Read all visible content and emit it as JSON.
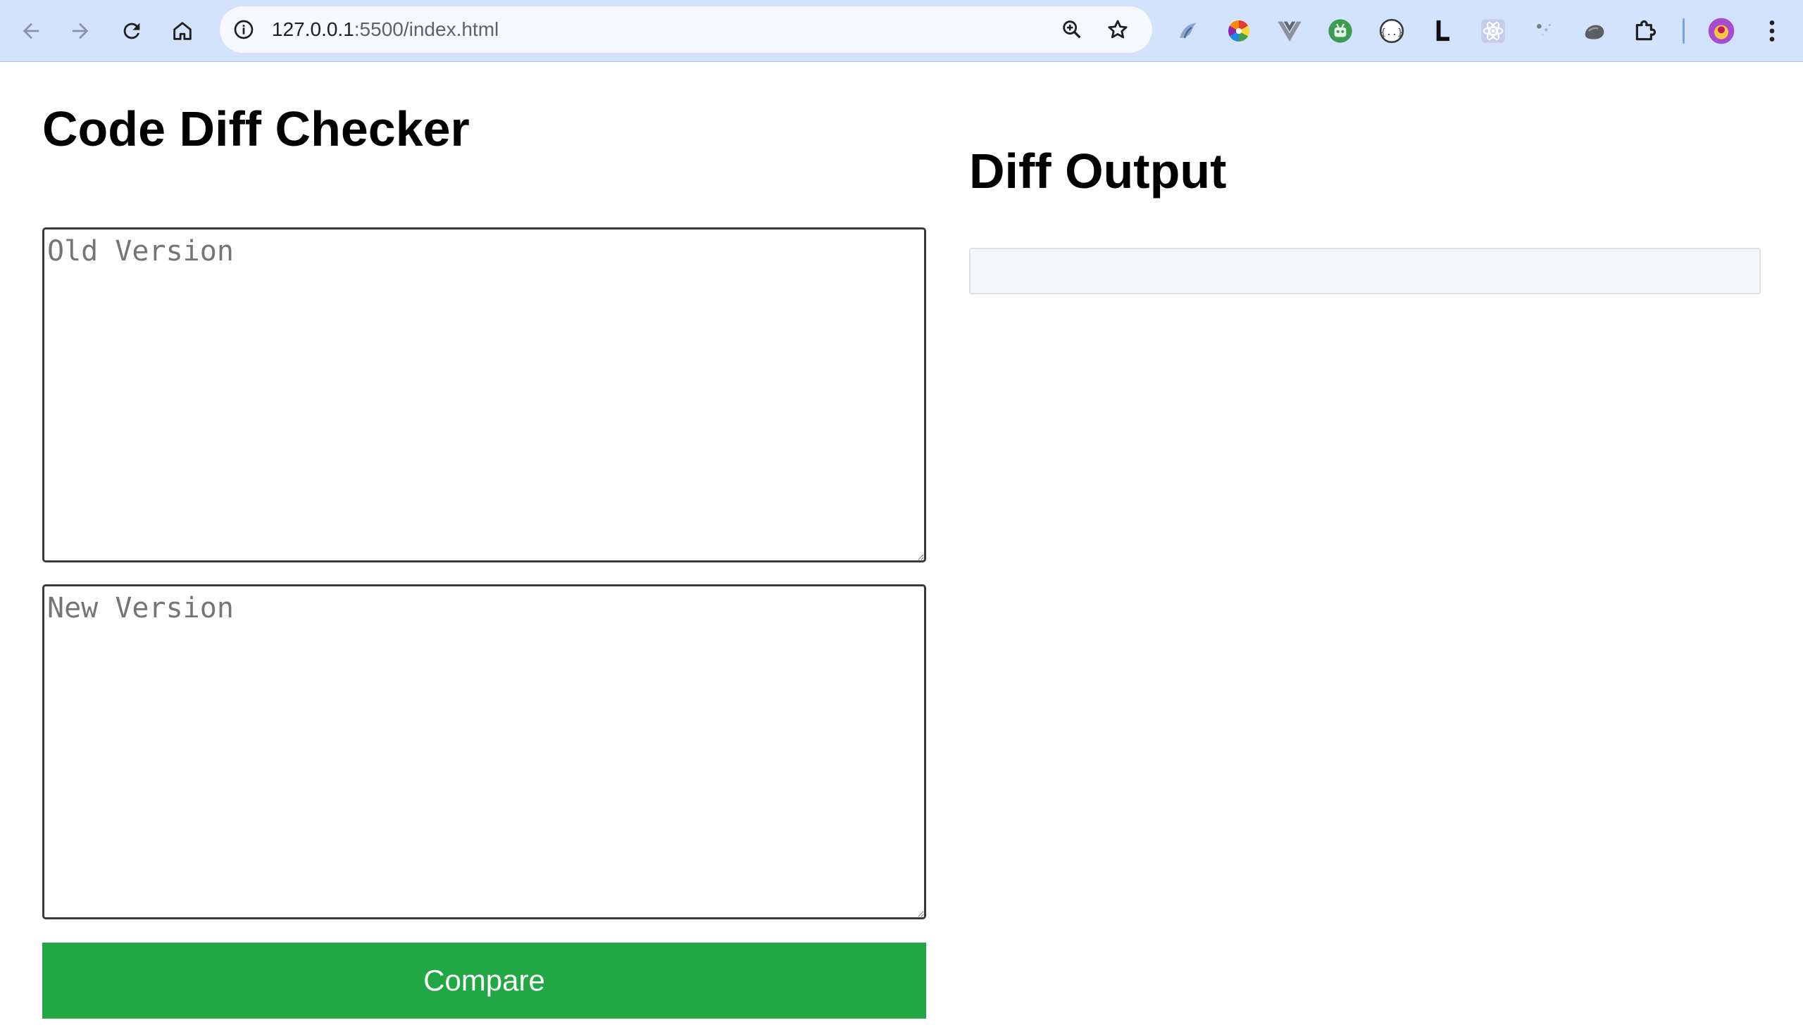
{
  "browser": {
    "url_host": "127.0.0.1",
    "url_rest": ":5500/index.html"
  },
  "page": {
    "title": "Code Diff Checker",
    "old_placeholder": "Old Version",
    "new_placeholder": "New Version",
    "compare_label": "Compare",
    "output_title": "Diff Output",
    "output_text": ""
  },
  "extensions": [
    "blue-feather-extension-icon",
    "color-wheel-extension-icon",
    "vue-extension-icon",
    "android-bot-extension-icon",
    "json-formatter-extension-icon",
    "l-letter-extension-icon",
    "react-extension-icon",
    "sparkle-extension-icon",
    "gray-stone-extension-icon",
    "puzzle-piece-icon"
  ],
  "colors": {
    "toolbar": "#d3e3fd",
    "compare_button": "#22a745",
    "output_background": "#f5f8fa"
  }
}
